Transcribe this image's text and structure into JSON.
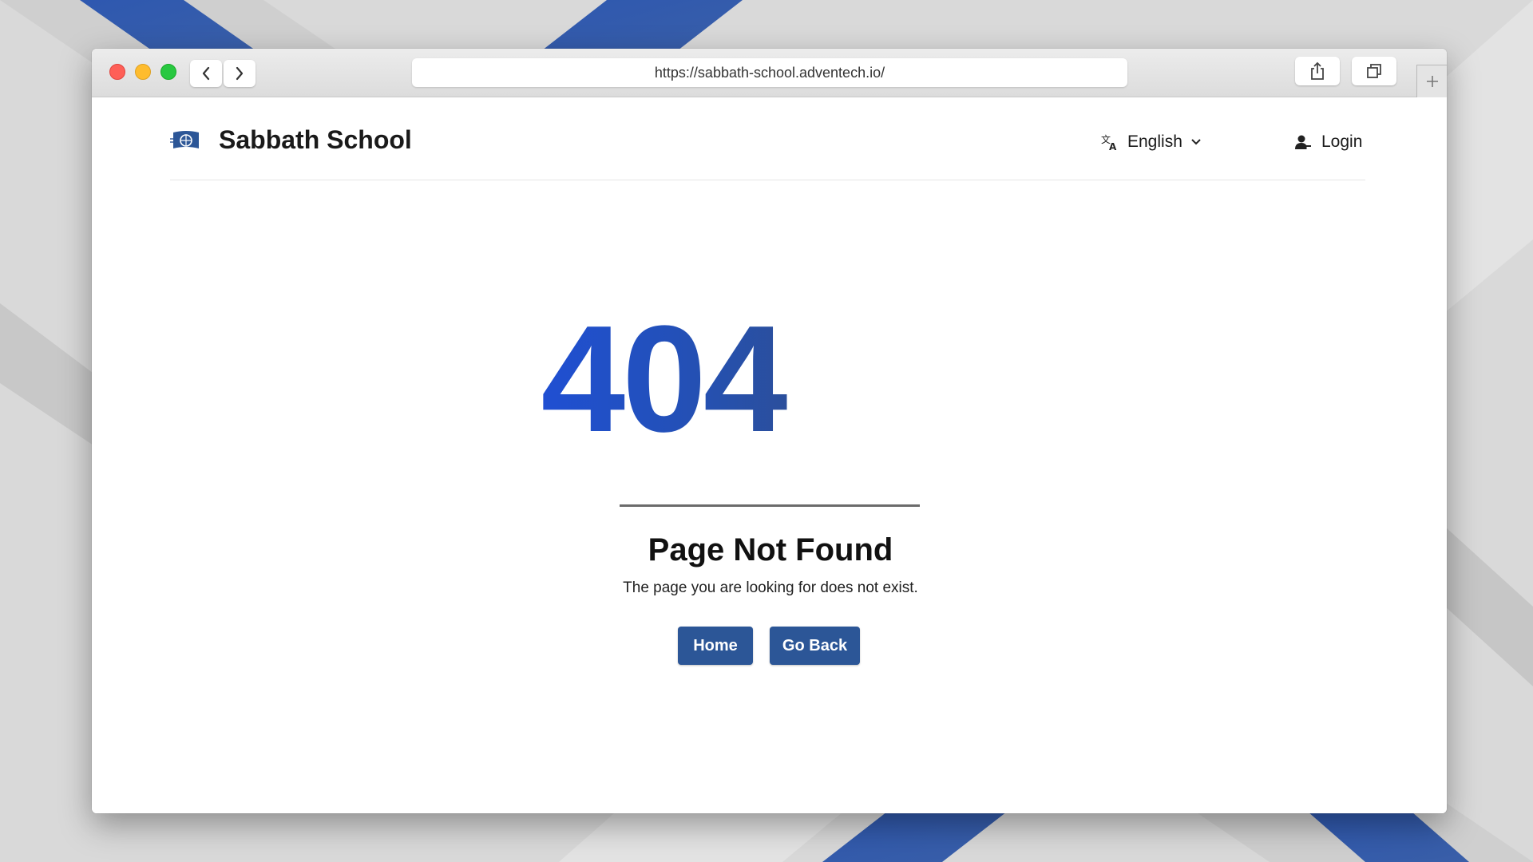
{
  "browser": {
    "url": "https://sabbath-school.adventech.io/",
    "icons": {
      "back": "chevron-left-icon",
      "forward": "chevron-right-icon",
      "share": "share-icon",
      "tabs": "tabs-icon",
      "new_tab": "plus-icon"
    }
  },
  "header": {
    "site_title": "Sabbath School",
    "language_label": "English",
    "login_label": "Login"
  },
  "error": {
    "code": "404",
    "title": "Page Not Found",
    "message": "The page you are looking for does not exist.",
    "home_label": "Home",
    "go_back_label": "Go Back"
  },
  "colors": {
    "accent": "#2c5697",
    "code_gradient_start": "#1f4fd6",
    "code_gradient_end": "#2c4f98"
  }
}
